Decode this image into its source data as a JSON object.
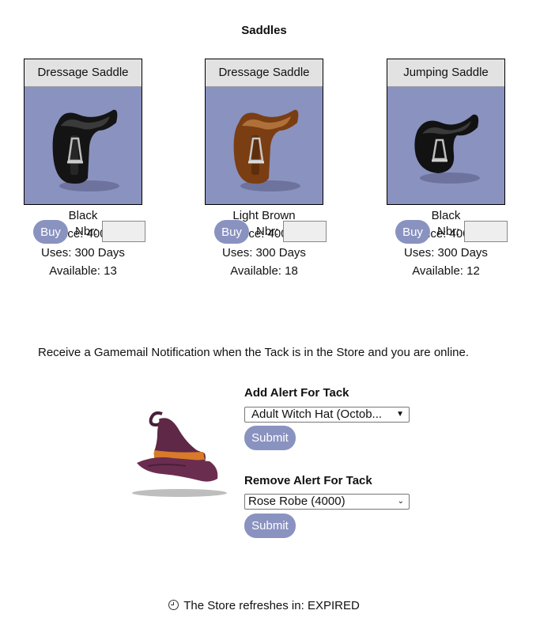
{
  "page": {
    "title": "Saddles"
  },
  "items": [
    {
      "name": "Dressage Saddle",
      "color": "Black",
      "price": "Price: 4000",
      "uses": "Uses: 300 Days",
      "available": "Available: 13",
      "buy_label": "Buy",
      "nbr_label": "Nbr:",
      "image": "black-dressage-saddle"
    },
    {
      "name": "Dressage Saddle",
      "color": "Light Brown",
      "price": "Price: 4000",
      "uses": "Uses: 300 Days",
      "available": "Available: 18",
      "buy_label": "Buy",
      "nbr_label": "Nbr:",
      "image": "light-brown-dressage-saddle"
    },
    {
      "name": "Jumping Saddle",
      "color": "Black",
      "price": "Price: 4000",
      "uses": "Uses: 300 Days",
      "available": "Available: 12",
      "buy_label": "Buy",
      "nbr_label": "Nbr:",
      "image": "black-jumping-saddle"
    }
  ],
  "notice": "Receive a Gamemail Notification when the Tack is in the Store and you are online.",
  "alerts": {
    "add_label": "Add Alert For Tack",
    "add_selected": "Adult Witch Hat (October)",
    "add_display": "Adult Witch Hat (Octob...",
    "remove_label": "Remove Alert For Tack",
    "remove_selected": "Rose Robe (4000)",
    "submit_label": "Submit",
    "image": "witch-hat"
  },
  "refresh": {
    "text": "The Store refreshes in: EXPIRED",
    "icon": "clock-icon"
  },
  "colors": {
    "accent": "#8a92c0",
    "name_bar": "#e2e2e2"
  }
}
